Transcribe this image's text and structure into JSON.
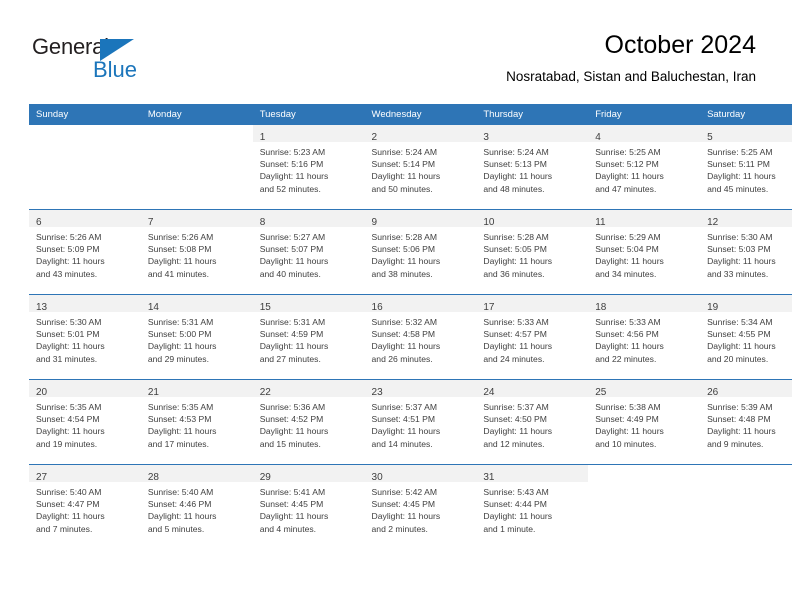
{
  "brand": {
    "name_top": "General",
    "name_bottom": "Blue",
    "accent_color": "#1b75bb"
  },
  "header": {
    "title": "October 2024",
    "subtitle": "Nosratabad, Sistan and Baluchestan, Iran"
  },
  "theme": {
    "header_blue": "#2e75b6",
    "daynum_band": "#f2f2f2",
    "text": "#404040"
  },
  "calendar": {
    "weekday_headers": [
      "Sunday",
      "Monday",
      "Tuesday",
      "Wednesday",
      "Thursday",
      "Friday",
      "Saturday"
    ],
    "weeks": [
      [
        {
          "day": "",
          "lines": []
        },
        {
          "day": "",
          "lines": []
        },
        {
          "day": "1",
          "lines": [
            "Sunrise: 5:23 AM",
            "Sunset: 5:16 PM",
            "Daylight: 11 hours",
            "and 52 minutes."
          ]
        },
        {
          "day": "2",
          "lines": [
            "Sunrise: 5:24 AM",
            "Sunset: 5:14 PM",
            "Daylight: 11 hours",
            "and 50 minutes."
          ]
        },
        {
          "day": "3",
          "lines": [
            "Sunrise: 5:24 AM",
            "Sunset: 5:13 PM",
            "Daylight: 11 hours",
            "and 48 minutes."
          ]
        },
        {
          "day": "4",
          "lines": [
            "Sunrise: 5:25 AM",
            "Sunset: 5:12 PM",
            "Daylight: 11 hours",
            "and 47 minutes."
          ]
        },
        {
          "day": "5",
          "lines": [
            "Sunrise: 5:25 AM",
            "Sunset: 5:11 PM",
            "Daylight: 11 hours",
            "and 45 minutes."
          ]
        }
      ],
      [
        {
          "day": "6",
          "lines": [
            "Sunrise: 5:26 AM",
            "Sunset: 5:09 PM",
            "Daylight: 11 hours",
            "and 43 minutes."
          ]
        },
        {
          "day": "7",
          "lines": [
            "Sunrise: 5:26 AM",
            "Sunset: 5:08 PM",
            "Daylight: 11 hours",
            "and 41 minutes."
          ]
        },
        {
          "day": "8",
          "lines": [
            "Sunrise: 5:27 AM",
            "Sunset: 5:07 PM",
            "Daylight: 11 hours",
            "and 40 minutes."
          ]
        },
        {
          "day": "9",
          "lines": [
            "Sunrise: 5:28 AM",
            "Sunset: 5:06 PM",
            "Daylight: 11 hours",
            "and 38 minutes."
          ]
        },
        {
          "day": "10",
          "lines": [
            "Sunrise: 5:28 AM",
            "Sunset: 5:05 PM",
            "Daylight: 11 hours",
            "and 36 minutes."
          ]
        },
        {
          "day": "11",
          "lines": [
            "Sunrise: 5:29 AM",
            "Sunset: 5:04 PM",
            "Daylight: 11 hours",
            "and 34 minutes."
          ]
        },
        {
          "day": "12",
          "lines": [
            "Sunrise: 5:30 AM",
            "Sunset: 5:03 PM",
            "Daylight: 11 hours",
            "and 33 minutes."
          ]
        }
      ],
      [
        {
          "day": "13",
          "lines": [
            "Sunrise: 5:30 AM",
            "Sunset: 5:01 PM",
            "Daylight: 11 hours",
            "and 31 minutes."
          ]
        },
        {
          "day": "14",
          "lines": [
            "Sunrise: 5:31 AM",
            "Sunset: 5:00 PM",
            "Daylight: 11 hours",
            "and 29 minutes."
          ]
        },
        {
          "day": "15",
          "lines": [
            "Sunrise: 5:31 AM",
            "Sunset: 4:59 PM",
            "Daylight: 11 hours",
            "and 27 minutes."
          ]
        },
        {
          "day": "16",
          "lines": [
            "Sunrise: 5:32 AM",
            "Sunset: 4:58 PM",
            "Daylight: 11 hours",
            "and 26 minutes."
          ]
        },
        {
          "day": "17",
          "lines": [
            "Sunrise: 5:33 AM",
            "Sunset: 4:57 PM",
            "Daylight: 11 hours",
            "and 24 minutes."
          ]
        },
        {
          "day": "18",
          "lines": [
            "Sunrise: 5:33 AM",
            "Sunset: 4:56 PM",
            "Daylight: 11 hours",
            "and 22 minutes."
          ]
        },
        {
          "day": "19",
          "lines": [
            "Sunrise: 5:34 AM",
            "Sunset: 4:55 PM",
            "Daylight: 11 hours",
            "and 20 minutes."
          ]
        }
      ],
      [
        {
          "day": "20",
          "lines": [
            "Sunrise: 5:35 AM",
            "Sunset: 4:54 PM",
            "Daylight: 11 hours",
            "and 19 minutes."
          ]
        },
        {
          "day": "21",
          "lines": [
            "Sunrise: 5:35 AM",
            "Sunset: 4:53 PM",
            "Daylight: 11 hours",
            "and 17 minutes."
          ]
        },
        {
          "day": "22",
          "lines": [
            "Sunrise: 5:36 AM",
            "Sunset: 4:52 PM",
            "Daylight: 11 hours",
            "and 15 minutes."
          ]
        },
        {
          "day": "23",
          "lines": [
            "Sunrise: 5:37 AM",
            "Sunset: 4:51 PM",
            "Daylight: 11 hours",
            "and 14 minutes."
          ]
        },
        {
          "day": "24",
          "lines": [
            "Sunrise: 5:37 AM",
            "Sunset: 4:50 PM",
            "Daylight: 11 hours",
            "and 12 minutes."
          ]
        },
        {
          "day": "25",
          "lines": [
            "Sunrise: 5:38 AM",
            "Sunset: 4:49 PM",
            "Daylight: 11 hours",
            "and 10 minutes."
          ]
        },
        {
          "day": "26",
          "lines": [
            "Sunrise: 5:39 AM",
            "Sunset: 4:48 PM",
            "Daylight: 11 hours",
            "and 9 minutes."
          ]
        }
      ],
      [
        {
          "day": "27",
          "lines": [
            "Sunrise: 5:40 AM",
            "Sunset: 4:47 PM",
            "Daylight: 11 hours",
            "and 7 minutes."
          ]
        },
        {
          "day": "28",
          "lines": [
            "Sunrise: 5:40 AM",
            "Sunset: 4:46 PM",
            "Daylight: 11 hours",
            "and 5 minutes."
          ]
        },
        {
          "day": "29",
          "lines": [
            "Sunrise: 5:41 AM",
            "Sunset: 4:45 PM",
            "Daylight: 11 hours",
            "and 4 minutes."
          ]
        },
        {
          "day": "30",
          "lines": [
            "Sunrise: 5:42 AM",
            "Sunset: 4:45 PM",
            "Daylight: 11 hours",
            "and 2 minutes."
          ]
        },
        {
          "day": "31",
          "lines": [
            "Sunrise: 5:43 AM",
            "Sunset: 4:44 PM",
            "Daylight: 11 hours",
            "and 1 minute."
          ]
        },
        {
          "day": "",
          "lines": []
        },
        {
          "day": "",
          "lines": []
        }
      ]
    ]
  }
}
